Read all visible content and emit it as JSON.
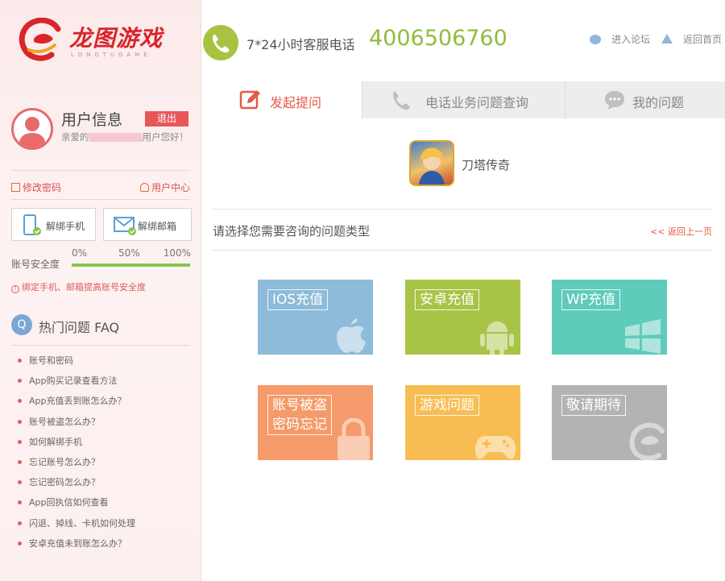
{
  "brand": {
    "name": "龙图游戏",
    "sub": "LONGTUGAME",
    "color": "#d8262b"
  },
  "user": {
    "title": "用户信息",
    "logout": "退出",
    "welcome_prefix": "亲爱的",
    "welcome_suffix": "用户您好！"
  },
  "links": {
    "change_password": "修改密码",
    "user_center": "用户中心"
  },
  "bind": {
    "phone": "解绑手机",
    "email": "解绑邮箱"
  },
  "security": {
    "label": "账号安全度",
    "ticks": [
      "0%",
      "50%",
      "100%"
    ],
    "level": 1.0,
    "tip": "绑定手机、邮箱提高账号安全度"
  },
  "faq": {
    "title": "热门问题 FAQ",
    "items": [
      "账号和密码",
      "App购买记录查看方法",
      "App充值丢到账怎么办？",
      "账号被盗怎么办？",
      "如何解绑手机",
      "忘记账号怎么办？",
      "忘记密码怎么办？",
      "App回执信如何查看",
      "闪退、掉线、卡机如何处理",
      "安卓充值未到账怎么办？"
    ]
  },
  "header": {
    "phone_label": "7*24小时客服电话",
    "phone_number": "4006506760",
    "forum": "进入论坛",
    "home": "返回首页"
  },
  "tabs": [
    {
      "label": "发起提问",
      "active": true
    },
    {
      "label": "电话业务问题查询",
      "active": false
    },
    {
      "label": "我的问题",
      "active": false
    }
  ],
  "game": {
    "name": "刀塔传奇"
  },
  "prompt": {
    "text": "请选择您需要咨询的问题类型",
    "back": "<< 返回上一页"
  },
  "tiles": [
    {
      "label": "IOS充值",
      "color": "#8dbbd9",
      "icon": "apple-icon"
    },
    {
      "label": "安卓充值",
      "color": "#a8c446",
      "icon": "android-icon"
    },
    {
      "label": "WP充值",
      "color": "#5fcbbb",
      "icon": "windows-icon"
    },
    {
      "label": "账号被盗\n密码忘记",
      "color": "#f59a6a",
      "icon": "lock-icon"
    },
    {
      "label": "游戏问题",
      "color": "#f8bd52",
      "icon": "gamepad-icon"
    },
    {
      "label": "敬请期待",
      "color": "#b3b3b3",
      "icon": "logo-icon"
    }
  ]
}
